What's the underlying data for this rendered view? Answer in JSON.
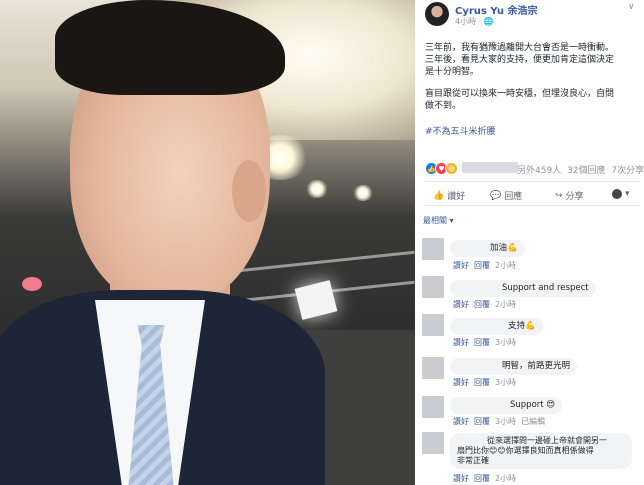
{
  "post": {
    "author": "Cyrus Yu 余浩宗",
    "time": "4小時 ·",
    "paragraph1": [
      "三年前，我有猶豫過離開大台會否是一時衝動。",
      "三年後，看見大家的支持，便更加肯定這個決定",
      "是十分明智。"
    ],
    "paragraph2": [
      "盲目跟從可以換來一時安穩，但埋沒良心，自問",
      "做不到。"
    ],
    "hashtag": "#不為五斗米折腰",
    "reaction_count_text": "另外459人",
    "comments_count": "32個回應",
    "shares_count": "7次分享",
    "actions": {
      "like": "讚好",
      "comment": "回應",
      "share": "分享"
    },
    "sort_label": "最相關 ▾"
  },
  "comments": [
    {
      "text": "加油💪",
      "like": "讚好",
      "reply": "回覆",
      "time": "2小時",
      "edited": ""
    },
    {
      "text": "Support and respect",
      "like": "讚好",
      "reply": "回覆",
      "time": "2小時",
      "edited": ""
    },
    {
      "text": "支持💪",
      "like": "讚好",
      "reply": "回覆",
      "time": "3小時",
      "edited": ""
    },
    {
      "text": "明智，前路更光明",
      "like": "讚好",
      "reply": "回覆",
      "time": "3小時",
      "edited": ""
    },
    {
      "text": "Support 😍",
      "like": "讚好",
      "reply": "回覆",
      "time": "3小時",
      "edited": "已編輯"
    },
    {
      "text_lines": [
        "從來選擇問一邊碰上帝就會開另一",
        "扇門比你😊😊你選擇良知而真相係做得",
        "非常正確"
      ],
      "like": "讚好",
      "reply": "回覆",
      "time": "2小時",
      "edited": ""
    }
  ],
  "colors": {
    "link": "#365899",
    "meta": "#90949c",
    "bubble": "#f2f3f5"
  }
}
